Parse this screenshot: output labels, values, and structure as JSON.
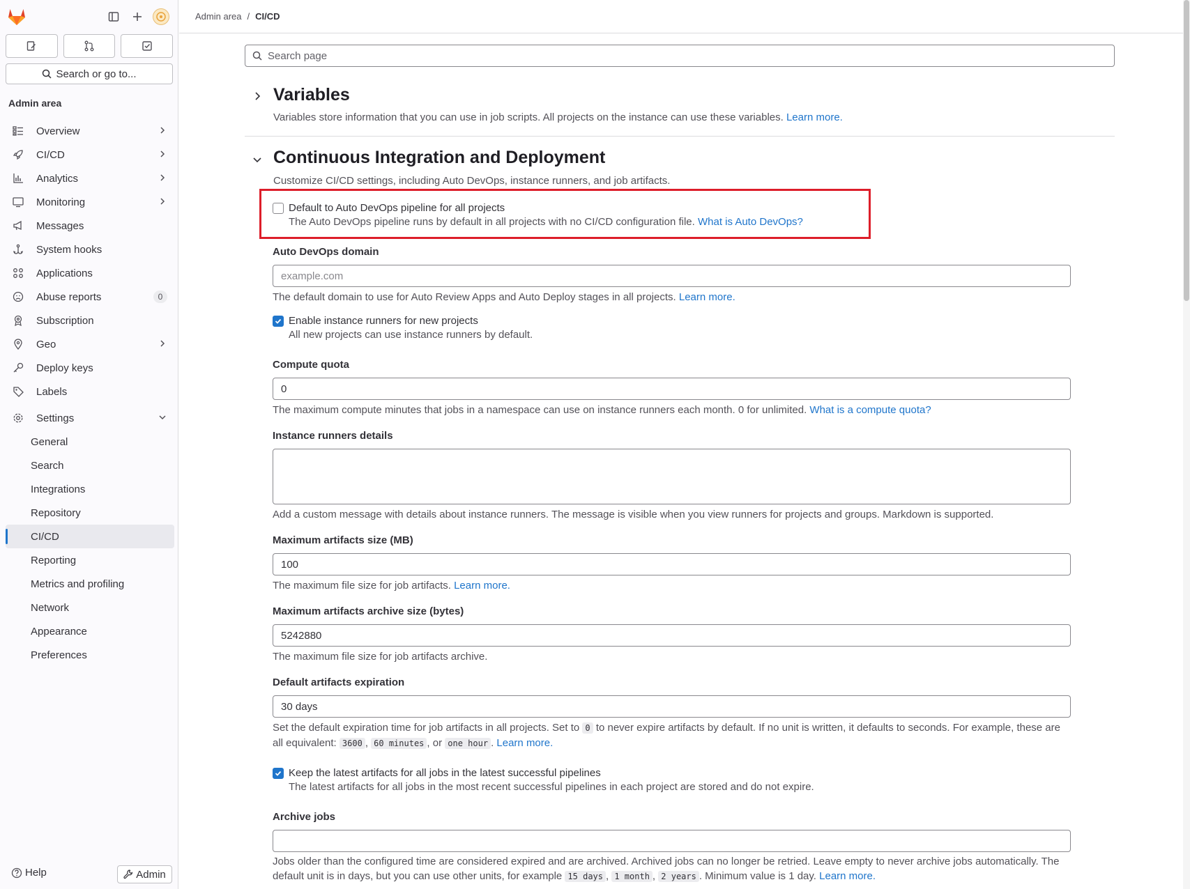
{
  "sidebar": {
    "title": "Admin area",
    "search_label": "Search or go to...",
    "items": [
      {
        "label": "Overview",
        "icon": "overview-icon",
        "has_chevron": true
      },
      {
        "label": "CI/CD",
        "icon": "rocket-icon",
        "has_chevron": true
      },
      {
        "label": "Analytics",
        "icon": "chart-icon",
        "has_chevron": true
      },
      {
        "label": "Monitoring",
        "icon": "monitor-icon",
        "has_chevron": true
      },
      {
        "label": "Messages",
        "icon": "bullhorn-icon",
        "has_chevron": false
      },
      {
        "label": "System hooks",
        "icon": "hook-icon",
        "has_chevron": false
      },
      {
        "label": "Applications",
        "icon": "applications-icon",
        "has_chevron": false
      },
      {
        "label": "Abuse reports",
        "icon": "abuse-icon",
        "badge": "0"
      },
      {
        "label": "Subscription",
        "icon": "subscription-icon",
        "has_chevron": false
      },
      {
        "label": "Geo",
        "icon": "location-icon",
        "has_chevron": true
      },
      {
        "label": "Deploy keys",
        "icon": "key-icon",
        "has_chevron": false
      },
      {
        "label": "Labels",
        "icon": "label-icon",
        "has_chevron": false
      },
      {
        "label": "Settings",
        "icon": "settings-icon",
        "expanded": true
      }
    ],
    "settings_items": [
      {
        "label": "General"
      },
      {
        "label": "Search"
      },
      {
        "label": "Integrations"
      },
      {
        "label": "Repository"
      },
      {
        "label": "CI/CD",
        "active": true
      },
      {
        "label": "Reporting"
      },
      {
        "label": "Metrics and profiling"
      },
      {
        "label": "Network"
      },
      {
        "label": "Appearance"
      },
      {
        "label": "Preferences"
      }
    ],
    "help_label": "Help",
    "admin_label": "Admin"
  },
  "breadcrumb": {
    "parent": "Admin area",
    "separator": "/",
    "current": "CI/CD"
  },
  "page_search": {
    "placeholder": "Search page"
  },
  "variables": {
    "title": "Variables",
    "description": "Variables store information that you can use in job scripts. All projects on the instance can use these variables.",
    "link": "Learn more."
  },
  "cicd": {
    "title": "Continuous Integration and Deployment",
    "description": "Customize CI/CD settings, including Auto DevOps, instance runners, and job artifacts.",
    "auto_devops": {
      "label": "Default to Auto DevOps pipeline for all projects",
      "checked": false,
      "help": "The Auto DevOps pipeline runs by default in all projects with no CI/CD configuration file.",
      "link": "What is Auto DevOps?"
    },
    "domain": {
      "label": "Auto DevOps domain",
      "placeholder": "example.com",
      "help": "The default domain to use for Auto Review Apps and Auto Deploy stages in all projects.",
      "link": "Learn more."
    },
    "instance_runners": {
      "label": "Enable instance runners for new projects",
      "checked": true,
      "help": "All new projects can use instance runners by default."
    },
    "compute_quota": {
      "label": "Compute quota",
      "value": "0",
      "help": "The maximum compute minutes that jobs in a namespace can use on instance runners each month. 0 for unlimited.",
      "link": "What is a compute quota?"
    },
    "runner_details": {
      "label": "Instance runners details",
      "value": "",
      "help": "Add a custom message with details about instance runners. The message is visible when you view runners for projects and groups. Markdown is supported."
    },
    "max_artifacts": {
      "label": "Maximum artifacts size (MB)",
      "value": "100",
      "help": "The maximum file size for job artifacts.",
      "link": "Learn more."
    },
    "max_archive": {
      "label": "Maximum artifacts archive size (bytes)",
      "value": "5242880",
      "help": "The maximum file size for job artifacts archive."
    },
    "expiration": {
      "label": "Default artifacts expiration",
      "value": "30 days",
      "help_1": "Set the default expiration time for job artifacts in all projects. Set to",
      "code_0": "0",
      "help_2": "to never expire artifacts by default. If no unit is written, it defaults to seconds. For example, these are all equivalent:",
      "code_1": "3600",
      "code_2": "60 minutes",
      "help_or": ", or",
      "code_3": "one hour",
      "link": "Learn more."
    },
    "keep_latest": {
      "label": "Keep the latest artifacts for all jobs in the latest successful pipelines",
      "checked": true,
      "help": "The latest artifacts for all jobs in the most recent successful pipelines in each project are stored and do not expire."
    },
    "archive_jobs": {
      "label": "Archive jobs",
      "value": "",
      "help_1": "Jobs older than the configured time are considered expired and are archived. Archived jobs can no longer be retried. Leave empty to never archive jobs automatically. The default unit is in days, but you can use other units, for example",
      "code_1": "15 days",
      "code_2": "1 month",
      "code_3": "2 years",
      "help_2": ". Minimum value is 1 day.",
      "link": "Learn more."
    }
  },
  "colors": {
    "link": "#1f75cb",
    "highlight_border": "#dd1e2a",
    "checkbox_checked": "#1f75cb"
  }
}
